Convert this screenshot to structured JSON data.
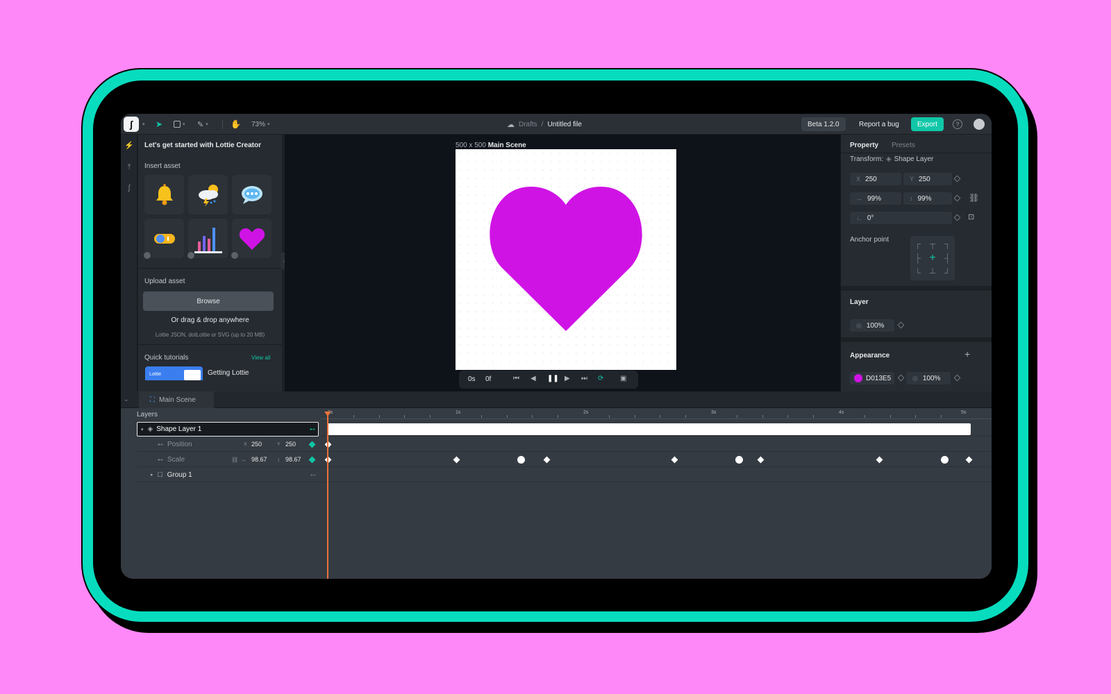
{
  "toolbar": {
    "zoom": "73%",
    "breadcrumb_parent": "Drafts",
    "breadcrumb_sep": "/",
    "file_name": "Untitled file",
    "beta": "Beta 1.2.0",
    "report_bug": "Report a bug",
    "export": "Export"
  },
  "left_panel": {
    "title": "Let's get started with Lottie Creator",
    "insert_asset": "Insert asset",
    "upload_asset": "Upload asset",
    "browse": "Browse",
    "drag_drop": "Or drag & drop anywhere",
    "formats": "Lottie JSON, dotLottie or SVG (up to 20 MB)",
    "quick_tutorials": "Quick tutorials",
    "view_all": "View all",
    "tutorial_title": "Getting Lottie",
    "tutorial_thumb": "Lottie",
    "assets": [
      "bell-icon",
      "weather-icon",
      "chat-bubble-icon",
      "toggle-icon",
      "bar-chart-icon",
      "heart-icon"
    ]
  },
  "canvas": {
    "size": "500 x 500",
    "scene": "Main Scene",
    "heart_color": "#D013E5"
  },
  "player": {
    "time": "0s",
    "frame": "0f"
  },
  "right_panel": {
    "tab_property": "Property",
    "tab_presets": "Presets",
    "transform_label": "Transform:",
    "transform_target": "Shape Layer",
    "x_label": "X",
    "x": "250",
    "y_label": "Y",
    "y": "250",
    "width": "99%",
    "height": "99%",
    "rotation": "0°",
    "anchor_point": "Anchor point",
    "layer_section": "Layer",
    "opacity": "100%",
    "appearance": "Appearance",
    "fill_hex": "D013E5",
    "fill_opacity": "100%"
  },
  "timeline": {
    "tab": "Main Scene",
    "layers_label": "Layers",
    "ruler": [
      "0s",
      "1s",
      "2s",
      "3s",
      "4s",
      "5s"
    ],
    "rows": {
      "layer_name": "Shape Layer 1",
      "position": "Position",
      "pos_x_label": "X",
      "pos_x": "250",
      "pos_y_label": "Y",
      "pos_y": "250",
      "scale": "Scale",
      "scale_x": "98.67",
      "scale_y": "98.67",
      "group": "Group 1"
    }
  }
}
